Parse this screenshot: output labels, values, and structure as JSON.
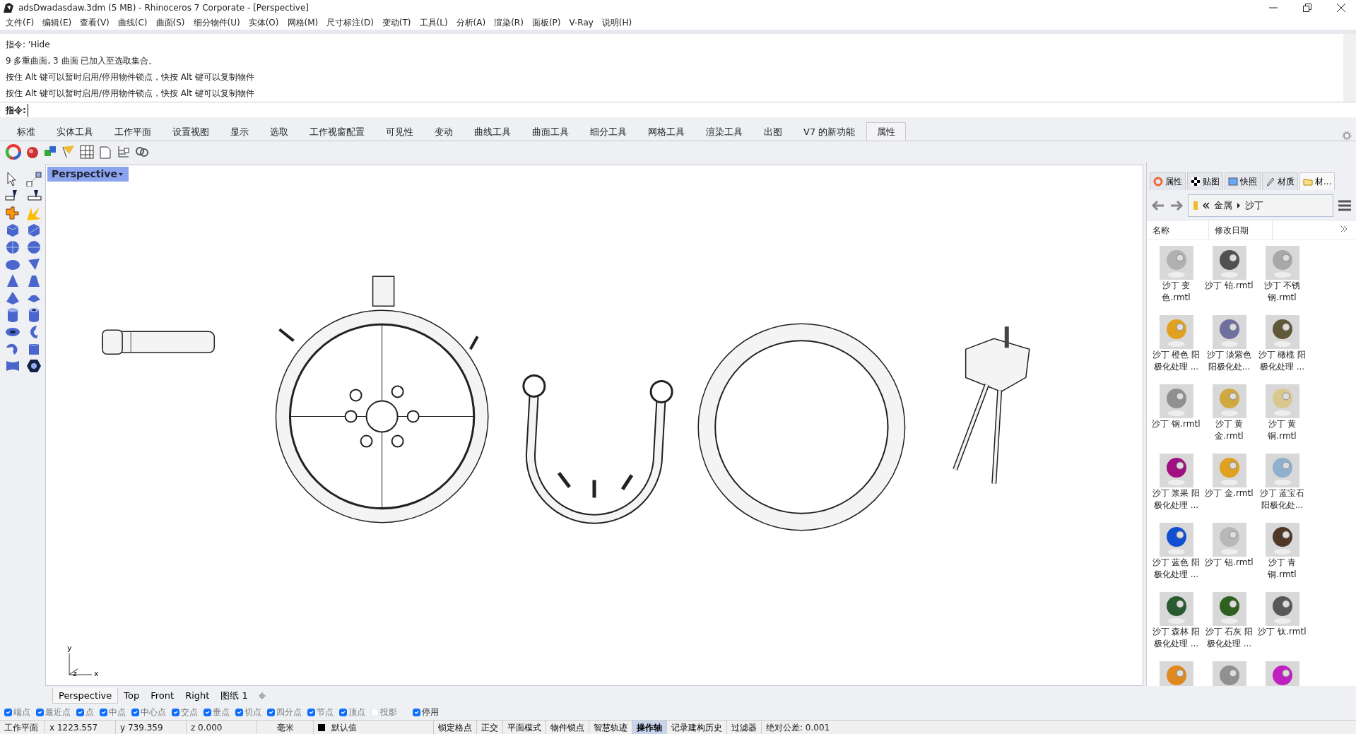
{
  "window": {
    "title": "adsDwadasdaw.3dm (5 MB) - Rhinoceros 7 Corporate - [Perspective]"
  },
  "menu": [
    "文件(F)",
    "编辑(E)",
    "查看(V)",
    "曲线(C)",
    "曲面(S)",
    "细分物件(U)",
    "实体(O)",
    "网格(M)",
    "尺寸标注(D)",
    "变动(T)",
    "工具(L)",
    "分析(A)",
    "渲染(R)",
    "面板(P)",
    "V-Ray",
    "说明(H)"
  ],
  "command_history": [
    "指令: 'Hide",
    "9 多重曲面, 3 曲面 已加入至选取集合。",
    "按住 Alt 键可以暂时启用/停用物件锁点，快按 Alt 键可以复制物件",
    "按住 Alt 键可以暂时启用/停用物件锁点，快按 Alt 键可以复制物件"
  ],
  "command_prompt": {
    "label": "指令:"
  },
  "toolbar_tabs": [
    {
      "label": "标准",
      "selected": false
    },
    {
      "label": "实体工具",
      "selected": false
    },
    {
      "label": "工作平面",
      "selected": false
    },
    {
      "label": "设置视图",
      "selected": false
    },
    {
      "label": "显示",
      "selected": false
    },
    {
      "label": "选取",
      "selected": false
    },
    {
      "label": "工作视窗配置",
      "selected": false
    },
    {
      "label": "可见性",
      "selected": false
    },
    {
      "label": "变动",
      "selected": false
    },
    {
      "label": "曲线工具",
      "selected": false
    },
    {
      "label": "曲面工具",
      "selected": false
    },
    {
      "label": "细分工具",
      "selected": false
    },
    {
      "label": "网格工具",
      "selected": false
    },
    {
      "label": "渲染工具",
      "selected": false
    },
    {
      "label": "出图",
      "selected": false
    },
    {
      "label": "V7 的新功能",
      "selected": false
    },
    {
      "label": "属性",
      "selected": true
    }
  ],
  "viewport": {
    "title": "Perspective",
    "axis_labels": [
      "y",
      "z",
      "x"
    ]
  },
  "viewport_tabs": [
    {
      "label": "Perspective",
      "selected": true
    },
    {
      "label": "Top",
      "selected": false
    },
    {
      "label": "Front",
      "selected": false
    },
    {
      "label": "Right",
      "selected": false
    },
    {
      "label": "图纸 1",
      "selected": false
    }
  ],
  "panel": {
    "tabs": [
      {
        "label": "属性",
        "selected": false
      },
      {
        "label": "贴图",
        "selected": false
      },
      {
        "label": "快照",
        "selected": false
      },
      {
        "label": "材质",
        "selected": false
      },
      {
        "label": "材...",
        "selected": true
      }
    ],
    "breadcrumb": [
      "金属",
      "沙丁"
    ],
    "columns": [
      "名称",
      "修改日期"
    ],
    "materials": [
      {
        "name": "沙丁 变色.rmtl",
        "color": "#b0b0b0"
      },
      {
        "name": "沙丁 铂.rmtl",
        "color": "#505050"
      },
      {
        "name": "沙丁 不锈钢.rmtl",
        "color": "#a8a8a8"
      },
      {
        "name": "沙丁 橙色 阳极化处理 ...",
        "color": "#e0a020"
      },
      {
        "name": "沙丁 淡紫色阳极化处...",
        "color": "#7070a0"
      },
      {
        "name": "沙丁 橄榄 阳极化处理 ...",
        "color": "#605838"
      },
      {
        "name": "沙丁 钢.rmtl",
        "color": "#909090"
      },
      {
        "name": "沙丁 黄金.rmtl",
        "color": "#d0a840"
      },
      {
        "name": "沙丁 黄铜.rmtl",
        "color": "#d8c890"
      },
      {
        "name": "沙丁 浆果 阳极化处理 ...",
        "color": "#a01080"
      },
      {
        "name": "沙丁 金.rmtl",
        "color": "#e0a020"
      },
      {
        "name": "沙丁 蓝宝石阳极化处...",
        "color": "#90b0d0"
      },
      {
        "name": "沙丁 蓝色 阳极化处理 ...",
        "color": "#1050d0"
      },
      {
        "name": "沙丁 铝.rmtl",
        "color": "#b8b8b8"
      },
      {
        "name": "沙丁 青铜.rmtl",
        "color": "#503828"
      },
      {
        "name": "沙丁 森林 阳极化处理 ...",
        "color": "#2a5a30"
      },
      {
        "name": "沙丁 石灰 阳极化处理 ...",
        "color": "#306020"
      },
      {
        "name": "沙丁 钛.rmtl",
        "color": "#585858"
      },
      {
        "color": "#e08820"
      },
      {
        "color": "#909090"
      },
      {
        "color": "#c020c0"
      }
    ]
  },
  "osnaps": [
    {
      "label": "端点",
      "checked": true
    },
    {
      "label": "最近点",
      "checked": true
    },
    {
      "label": "点",
      "checked": true
    },
    {
      "label": "中点",
      "checked": true
    },
    {
      "label": "中心点",
      "checked": true
    },
    {
      "label": "交点",
      "checked": true
    },
    {
      "label": "垂点",
      "checked": true
    },
    {
      "label": "切点",
      "checked": true
    },
    {
      "label": "四分点",
      "checked": true
    },
    {
      "label": "节点",
      "checked": true
    },
    {
      "label": "顶点",
      "checked": true
    },
    {
      "label": "投影",
      "checked": false
    },
    {
      "label": "停用",
      "checked": true
    }
  ],
  "status_bar": {
    "plane": "工作平面",
    "x": "x 1223.557",
    "y": "y 739.359",
    "z": "z 0.000",
    "units": "毫米",
    "layer": "默认值",
    "toggles": [
      {
        "label": "锁定格点",
        "on": false
      },
      {
        "label": "正交",
        "on": false
      },
      {
        "label": "平面模式",
        "on": false
      },
      {
        "label": "物件锁点",
        "on": false
      },
      {
        "label": "智慧轨迹",
        "on": false
      },
      {
        "label": "操作轴",
        "on": true
      },
      {
        "label": "记录建构历史",
        "on": false
      },
      {
        "label": "过滤器",
        "on": false
      }
    ],
    "tolerance": "绝对公差: 0.001"
  }
}
